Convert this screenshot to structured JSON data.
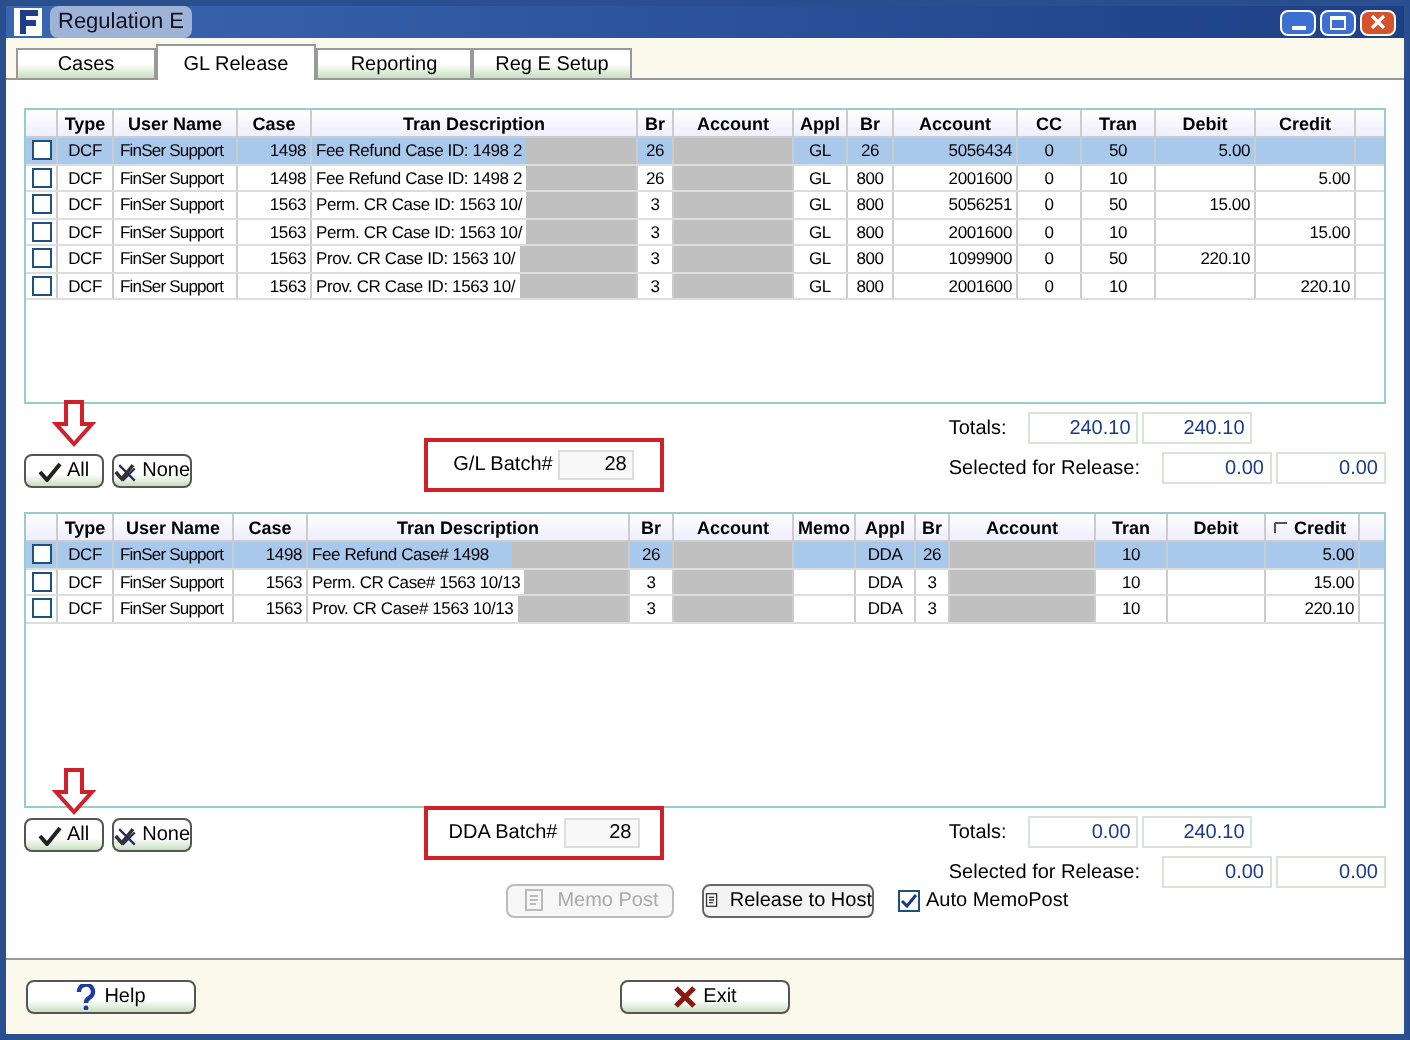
{
  "window": {
    "title": "Regulation E"
  },
  "tabs": [
    {
      "label": "Cases",
      "selected": false
    },
    {
      "label": "GL Release",
      "selected": true
    },
    {
      "label": "Reporting",
      "selected": false
    },
    {
      "label": "Reg E Setup",
      "selected": false
    }
  ],
  "gl_table": {
    "columns": [
      "Type",
      "User Name",
      "Case",
      "Tran Description",
      "Br",
      "Account",
      "Appl",
      "Br",
      "Account",
      "CC",
      "Tran",
      "Debit",
      "Credit"
    ],
    "rows": [
      {
        "selected": true,
        "checked": false,
        "cells": [
          "DCF",
          "FinSer Support",
          "1498",
          "Fee Refund Case ID: 1498 2",
          "26",
          "",
          "GL",
          "26",
          "5056434",
          "0",
          "50",
          "5.00",
          ""
        ]
      },
      {
        "selected": false,
        "checked": false,
        "cells": [
          "DCF",
          "FinSer Support",
          "1498",
          "Fee Refund Case ID: 1498 2",
          "26",
          "",
          "GL",
          "800",
          "2001600",
          "0",
          "10",
          "",
          "5.00"
        ]
      },
      {
        "selected": false,
        "checked": false,
        "cells": [
          "DCF",
          "FinSer Support",
          "1563",
          "Perm. CR Case ID: 1563 10/",
          "3",
          "",
          "GL",
          "800",
          "5056251",
          "0",
          "50",
          "15.00",
          ""
        ]
      },
      {
        "selected": false,
        "checked": false,
        "cells": [
          "DCF",
          "FinSer Support",
          "1563",
          "Perm. CR Case ID: 1563 10/",
          "3",
          "",
          "GL",
          "800",
          "2001600",
          "0",
          "10",
          "",
          "15.00"
        ]
      },
      {
        "selected": false,
        "checked": false,
        "cells": [
          "DCF",
          "FinSer Support",
          "1563",
          "Prov. CR Case ID: 1563 10/",
          "3",
          "",
          "GL",
          "800",
          "1099900",
          "0",
          "50",
          "220.10",
          ""
        ]
      },
      {
        "selected": false,
        "checked": false,
        "cells": [
          "DCF",
          "FinSer Support",
          "1563",
          "Prov. CR Case ID: 1563 10/",
          "3",
          "",
          "GL",
          "800",
          "2001600",
          "0",
          "10",
          "",
          "220.10"
        ]
      }
    ]
  },
  "gl_controls": {
    "all_button": "All",
    "none_button": "None",
    "batch_label": "G/L Batch#",
    "batch_value": "28",
    "totals_label": "Totals:",
    "totals": [
      "240.10",
      "240.10"
    ],
    "selected_label": "Selected for Release:",
    "selected": [
      "0.00",
      "0.00"
    ]
  },
  "dda_table": {
    "columns": [
      "Type",
      "User Name",
      "Case",
      "Tran Description",
      "Br",
      "Account",
      "Memo",
      "Appl",
      "Br",
      "Account",
      "Tran",
      "Debit",
      "Credit"
    ],
    "rows": [
      {
        "selected": true,
        "checked": false,
        "cells": [
          "DCF",
          "FinSer Support",
          "1498",
          "Fee Refund Case# 1498",
          "26",
          "",
          "",
          "DDA",
          "26",
          "",
          "10",
          "",
          "5.00"
        ]
      },
      {
        "selected": false,
        "checked": false,
        "cells": [
          "DCF",
          "FinSer Support",
          "1563",
          "Perm. CR Case# 1563 10/13",
          "3",
          "",
          "",
          "DDA",
          "3",
          "",
          "10",
          "",
          "15.00"
        ]
      },
      {
        "selected": false,
        "checked": false,
        "cells": [
          "DCF",
          "FinSer Support",
          "1563",
          "Prov. CR Case# 1563 10/13",
          "3",
          "",
          "",
          "DDA",
          "3",
          "",
          "10",
          "",
          "220.10"
        ]
      }
    ]
  },
  "dda_controls": {
    "all_button": "All",
    "none_button": "None",
    "batch_label": "DDA Batch#",
    "batch_value": "28",
    "totals_label": "Totals:",
    "totals": [
      "0.00",
      "240.10"
    ],
    "selected_label": "Selected for Release:",
    "selected": [
      "0.00",
      "0.00"
    ]
  },
  "memo_post_button": {
    "label": "Memo Post",
    "disabled": true
  },
  "release_button": {
    "label": "Release to Host",
    "disabled": false
  },
  "auto_memopost": {
    "label": "Auto MemoPost",
    "checked": true
  },
  "footer": {
    "help_button": "Help",
    "exit_button": "Exit"
  }
}
